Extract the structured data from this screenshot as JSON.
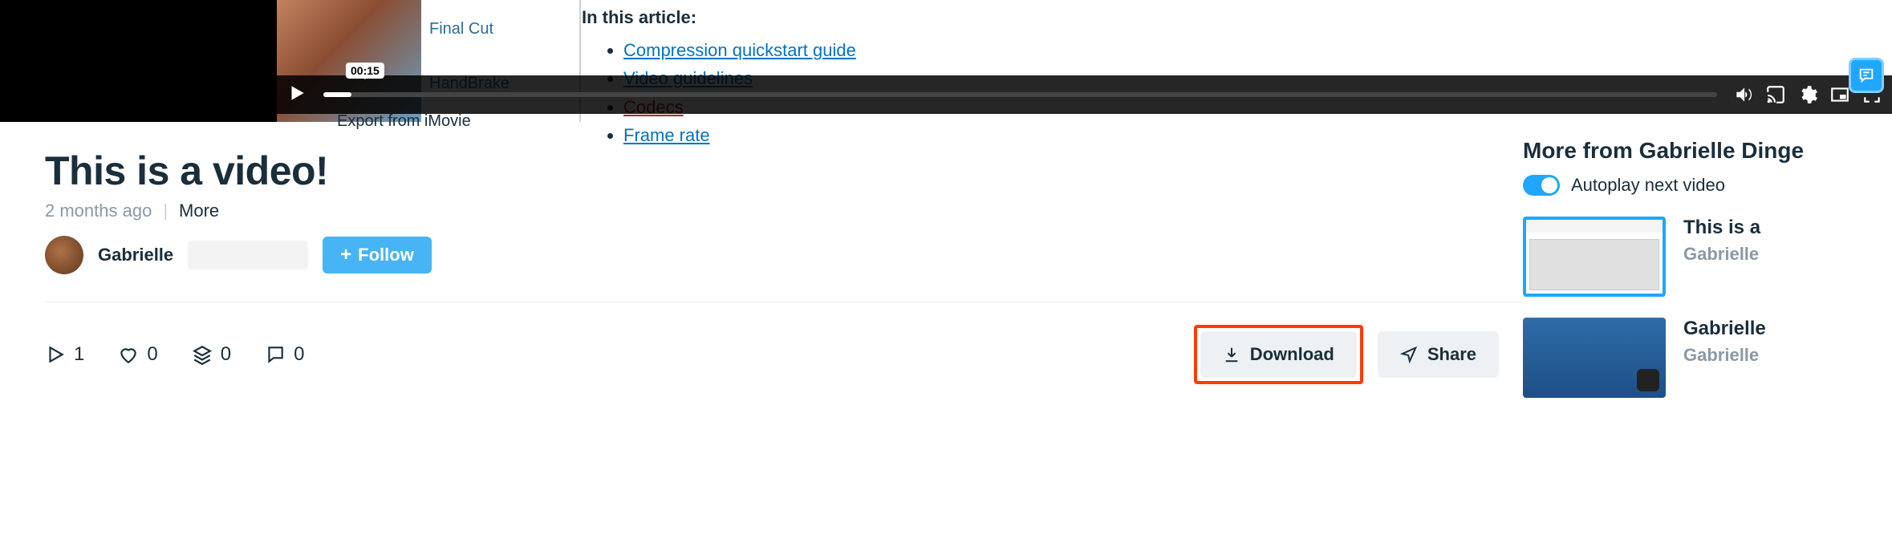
{
  "video": {
    "timecode": "00:15",
    "article_heading": "In this article:",
    "article_links": [
      "Compression quickstart guide",
      "Video guidelines",
      "Codecs",
      "Frame rate"
    ],
    "left_labels": [
      "Final Cut",
      "HandBrake"
    ],
    "bottom_caption": "Export from iMovie"
  },
  "page": {
    "title": "This is a video!",
    "age": "2 months ago",
    "more_label": "More"
  },
  "author": {
    "name": "Gabrielle",
    "follow_label": "Follow"
  },
  "stats": {
    "plays": "1",
    "likes": "0",
    "collections": "0",
    "comments": "0"
  },
  "actions": {
    "download": "Download",
    "share": "Share"
  },
  "sidebar": {
    "heading": "More from Gabrielle Dinge",
    "autoplay_label": "Autoplay next video",
    "items": [
      {
        "title": "This is a",
        "byline": "Gabrielle "
      },
      {
        "title": "Gabrielle",
        "byline": "Gabrielle "
      }
    ]
  }
}
